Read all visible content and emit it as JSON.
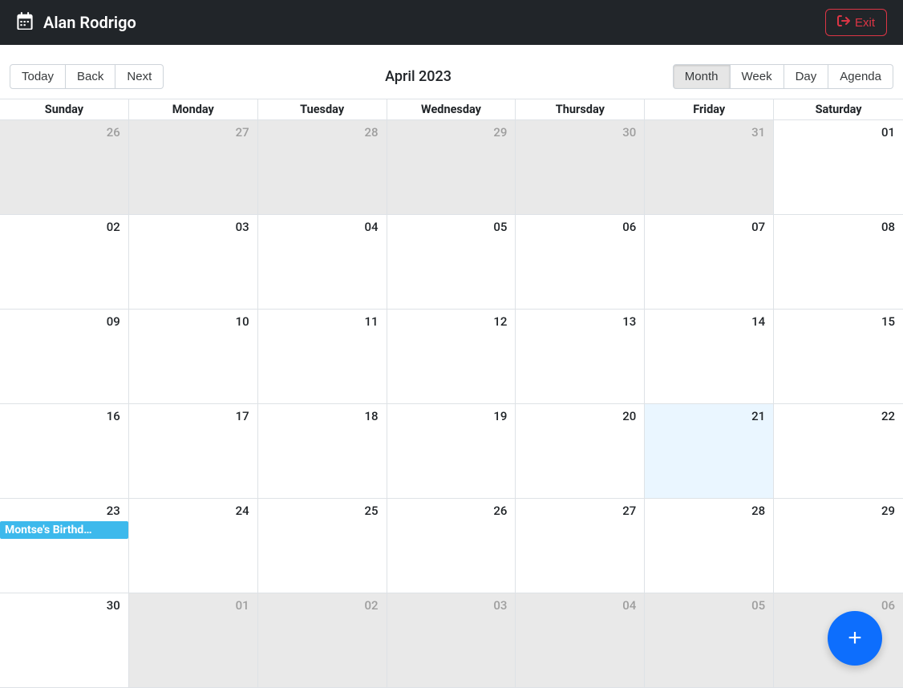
{
  "header": {
    "user_name": "Alan Rodrigo",
    "exit_label": "Exit"
  },
  "toolbar": {
    "today_label": "Today",
    "back_label": "Back",
    "next_label": "Next",
    "title": "April 2023",
    "views": {
      "month": "Month",
      "week": "Week",
      "day": "Day",
      "agenda": "Agenda"
    },
    "active_view": "month"
  },
  "weekdays": [
    "Sunday",
    "Monday",
    "Tuesday",
    "Wednesday",
    "Thursday",
    "Friday",
    "Saturday"
  ],
  "grid": [
    [
      {
        "num": "26",
        "off": true
      },
      {
        "num": "27",
        "off": true
      },
      {
        "num": "28",
        "off": true
      },
      {
        "num": "29",
        "off": true
      },
      {
        "num": "30",
        "off": true
      },
      {
        "num": "31",
        "off": true
      },
      {
        "num": "01",
        "off": false
      }
    ],
    [
      {
        "num": "02",
        "off": false
      },
      {
        "num": "03",
        "off": false
      },
      {
        "num": "04",
        "off": false
      },
      {
        "num": "05",
        "off": false
      },
      {
        "num": "06",
        "off": false
      },
      {
        "num": "07",
        "off": false
      },
      {
        "num": "08",
        "off": false
      }
    ],
    [
      {
        "num": "09",
        "off": false
      },
      {
        "num": "10",
        "off": false
      },
      {
        "num": "11",
        "off": false
      },
      {
        "num": "12",
        "off": false
      },
      {
        "num": "13",
        "off": false
      },
      {
        "num": "14",
        "off": false
      },
      {
        "num": "15",
        "off": false
      }
    ],
    [
      {
        "num": "16",
        "off": false
      },
      {
        "num": "17",
        "off": false
      },
      {
        "num": "18",
        "off": false
      },
      {
        "num": "19",
        "off": false
      },
      {
        "num": "20",
        "off": false
      },
      {
        "num": "21",
        "off": false,
        "today": true
      },
      {
        "num": "22",
        "off": false
      }
    ],
    [
      {
        "num": "23",
        "off": false,
        "event": "Montse's Birthd…"
      },
      {
        "num": "24",
        "off": false
      },
      {
        "num": "25",
        "off": false
      },
      {
        "num": "26",
        "off": false
      },
      {
        "num": "27",
        "off": false
      },
      {
        "num": "28",
        "off": false
      },
      {
        "num": "29",
        "off": false
      }
    ],
    [
      {
        "num": "30",
        "off": false
      },
      {
        "num": "01",
        "off": true
      },
      {
        "num": "02",
        "off": true
      },
      {
        "num": "03",
        "off": true
      },
      {
        "num": "04",
        "off": true
      },
      {
        "num": "05",
        "off": true
      },
      {
        "num": "06",
        "off": true
      }
    ]
  ],
  "fab": {
    "label": "+"
  },
  "colors": {
    "topbar_bg": "#212529",
    "exit": "#dc3545",
    "today_bg": "#eaf6ff",
    "off_bg": "#e9e9e9",
    "event_bg": "#3db9ec",
    "fab_bg": "#0d6efd"
  }
}
